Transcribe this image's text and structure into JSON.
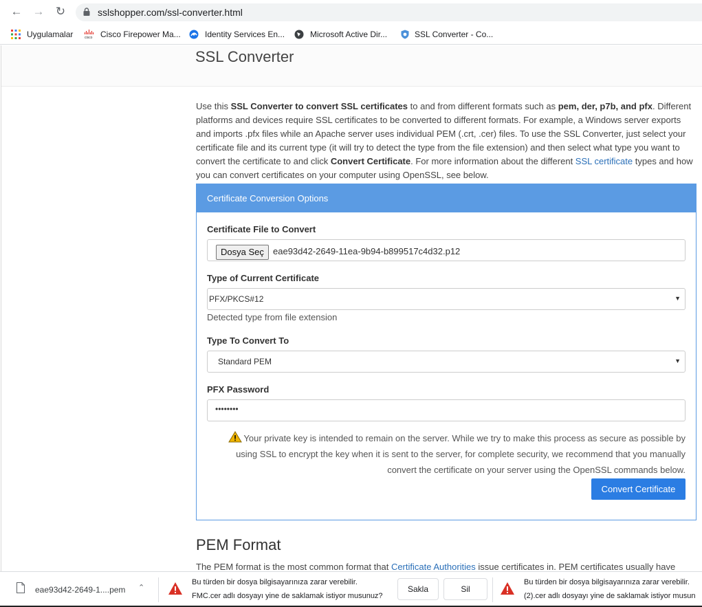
{
  "browser": {
    "url": "sslshopper.com/ssl-converter.html",
    "bookmarks": [
      {
        "label": "Uygulamalar",
        "icon": "apps-grid-icon"
      },
      {
        "label": "Cisco Firepower Ma...",
        "icon": "cisco-logo-icon"
      },
      {
        "label": "Identity Services En...",
        "icon": "identity-services-icon"
      },
      {
        "label": "Microsoft Active Dir...",
        "icon": "globe-icon"
      },
      {
        "label": "SSL Converter - Co...",
        "icon": "ssl-shield-icon"
      }
    ]
  },
  "page": {
    "title": "SSL Converter",
    "intro": {
      "p1": "Use this ",
      "b1": "SSL Converter to convert SSL certificates",
      "p2": " to and from different formats such as ",
      "b2": "pem, der, p7b, and pfx",
      "p3": ". Different platforms and devices require SSL certificates to be converted to different formats. For example, a Windows server exports and imports .pfx files while an Apache server uses individual PEM (.crt, .cer) files. To use the SSL Converter, just select your certificate file and its current type (it will try to detect the type from the file extension) and then select what type you want to convert the certificate to and click ",
      "b3": "Convert Certificate",
      "p4": ". For more information about the different ",
      "link": "SSL certificate",
      "p5": " types and how you can convert certificates on your computer using OpenSSL, see below."
    },
    "form": {
      "header": "Certificate Conversion Options",
      "file_label": "Certificate File to Convert",
      "file_button": "Dosya Seç",
      "file_name": "eae93d42-2649-11ea-9b94-b899517c4d32.p12",
      "current_type_label": "Type of Current Certificate",
      "current_type_value": "PFX/PKCS#12",
      "detected_note": "Detected type from file extension",
      "convert_to_label": "Type To Convert To",
      "convert_to_value": "Standard PEM",
      "password_label": "PFX Password",
      "password_value": "••••••••",
      "warning": "Your private key is intended to remain on the server. While we try to make this process as secure as possible by using SSL to encrypt the key when it is sent to the server, for complete security, we recommend that you manually convert the certificate on your server using the OpenSSL commands below.",
      "convert_button": "Convert Certificate"
    },
    "pem": {
      "heading": "PEM Format",
      "t1": "The PEM format is the most common format that ",
      "link": "Certificate Authorities",
      "t2": " issue certificates in. PEM certificates usually have"
    }
  },
  "downloads": {
    "file_name": "eae93d42-2649-1....pem",
    "warn1_line1": "Bu türden bir dosya bilgisayarınıza zarar verebilir.",
    "warn1_line2": "FMC.cer adlı dosyayı yine de saklamak istiyor musunuz?",
    "keep_label": "Sakla",
    "discard_label": "Sil",
    "warn2_line1": "Bu türden bir dosya bilgisayarınıza zarar verebilir.",
    "warn2_line2": "(2).cer adlı dosyayı yine de saklamak istiyor musun"
  }
}
